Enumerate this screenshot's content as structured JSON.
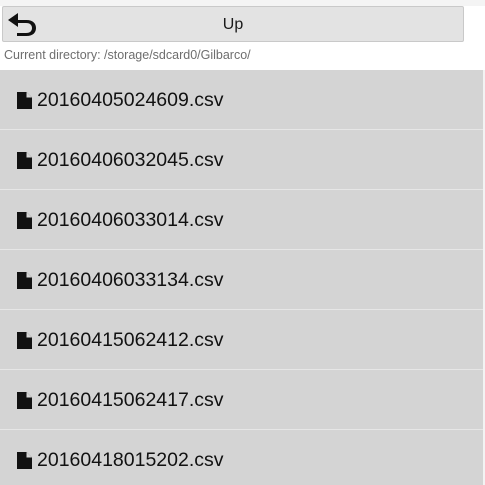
{
  "toolbar": {
    "up_label": "Up",
    "up_icon": "back-arrow-icon"
  },
  "current_directory": "Current directory: /storage/sdcard0/Gilbarco/",
  "file_icon": "file-icon",
  "files": [
    {
      "name": "20160405024609.csv"
    },
    {
      "name": "20160406032045.csv"
    },
    {
      "name": "20160406033014.csv"
    },
    {
      "name": "20160406033134.csv"
    },
    {
      "name": "20160415062412.csv"
    },
    {
      "name": "20160415062417.csv"
    },
    {
      "name": "20160418015202.csv"
    }
  ],
  "colors": {
    "list_background": "#d4d4d4",
    "row_divider": "#e6e6e6",
    "button_background": "#e3e3e3",
    "secondary_text": "#6e6e6e"
  }
}
